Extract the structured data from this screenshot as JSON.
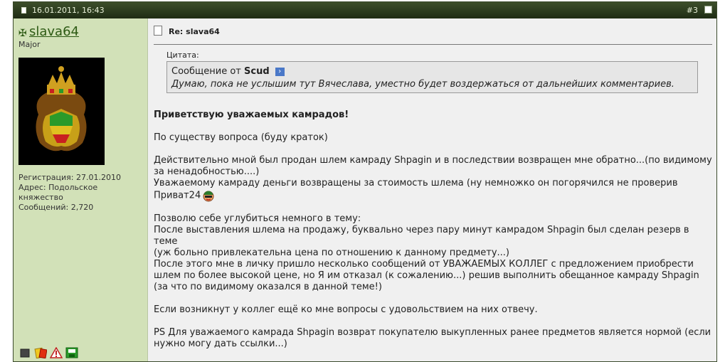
{
  "header": {
    "date": "16.01.2011, 16:43",
    "post_number": "#3"
  },
  "user": {
    "name": "slava64",
    "title": "Major",
    "info": [
      "Регистрация: 27.01.2010",
      "Адрес: Подольское",
      "княжество",
      "Сообщений: 2,720"
    ]
  },
  "message": {
    "title": "Re: slava64",
    "quote_label": "Цитата:",
    "quote_from_prefix": "Сообщение от",
    "quote_author": "Scud",
    "quote_text": "Думаю, пока не услышим тут Вячеслава, уместно будет воздержаться от дальнейших комментариев.",
    "greeting": "Приветствую уважаемых камрадов!",
    "p1": "По существу вопроса (буду краток)",
    "p2_l1": "Действительно мной был продан шлем камраду Shpagin и в последствии возвращен мне обратно...(по видимому",
    "p2_l2": "за ненадобностью....)",
    "p2_l3": "Уважаемому камраду деньги возвращены за стоимость шлема (ну немножко он погорячился не проверив",
    "p2_l4": "Приват24",
    "p3_l1": "Позволю себе углубиться немного в тему:",
    "p3_l2": "После выставления шлема на продажу, буквально через пару минут камрадом Shpagin был сделан резерв в теме",
    "p3_l3": "(уж больно привлекательна цена по отношению к данному предмету...)",
    "p3_l4": "После этого мне в личку пришло несколько сообщений от УВАЖАЕМЫХ КОЛЛЕГ с предложением приобрести",
    "p3_l5": "шлем по более высокой цене, но Я им отказал (к сожалению...) решив выполнить обещанное камраду Shpagin",
    "p3_l6": "(за что по видимому оказался в данной теме!)",
    "p4": "Если возникнут у коллег ещё ко мне вопросы с удовольствием на них отвечу.",
    "p5_l1": "PS Для уважаемого камрада Shpagin возврат покупателю выкупленных ранее предметов является нормой (если",
    "p5_l2": "нужно могу дать ссылки...)"
  },
  "colors": {
    "header": "#2f3f20",
    "sidebar": "#d2e1b8",
    "username": "#2d5a14"
  }
}
